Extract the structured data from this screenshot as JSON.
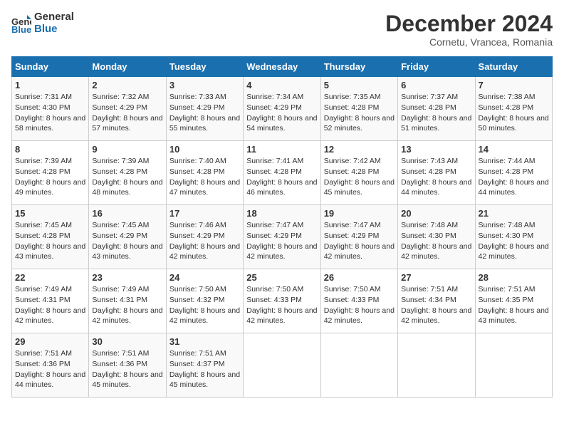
{
  "header": {
    "logo_line1": "General",
    "logo_line2": "Blue",
    "month": "December 2024",
    "location": "Cornetu, Vrancea, Romania"
  },
  "weekdays": [
    "Sunday",
    "Monday",
    "Tuesday",
    "Wednesday",
    "Thursday",
    "Friday",
    "Saturday"
  ],
  "weeks": [
    [
      {
        "day": "1",
        "sunrise": "Sunrise: 7:31 AM",
        "sunset": "Sunset: 4:30 PM",
        "daylight": "Daylight: 8 hours and 58 minutes."
      },
      {
        "day": "2",
        "sunrise": "Sunrise: 7:32 AM",
        "sunset": "Sunset: 4:29 PM",
        "daylight": "Daylight: 8 hours and 57 minutes."
      },
      {
        "day": "3",
        "sunrise": "Sunrise: 7:33 AM",
        "sunset": "Sunset: 4:29 PM",
        "daylight": "Daylight: 8 hours and 55 minutes."
      },
      {
        "day": "4",
        "sunrise": "Sunrise: 7:34 AM",
        "sunset": "Sunset: 4:29 PM",
        "daylight": "Daylight: 8 hours and 54 minutes."
      },
      {
        "day": "5",
        "sunrise": "Sunrise: 7:35 AM",
        "sunset": "Sunset: 4:28 PM",
        "daylight": "Daylight: 8 hours and 52 minutes."
      },
      {
        "day": "6",
        "sunrise": "Sunrise: 7:37 AM",
        "sunset": "Sunset: 4:28 PM",
        "daylight": "Daylight: 8 hours and 51 minutes."
      },
      {
        "day": "7",
        "sunrise": "Sunrise: 7:38 AM",
        "sunset": "Sunset: 4:28 PM",
        "daylight": "Daylight: 8 hours and 50 minutes."
      }
    ],
    [
      {
        "day": "8",
        "sunrise": "Sunrise: 7:39 AM",
        "sunset": "Sunset: 4:28 PM",
        "daylight": "Daylight: 8 hours and 49 minutes."
      },
      {
        "day": "9",
        "sunrise": "Sunrise: 7:39 AM",
        "sunset": "Sunset: 4:28 PM",
        "daylight": "Daylight: 8 hours and 48 minutes."
      },
      {
        "day": "10",
        "sunrise": "Sunrise: 7:40 AM",
        "sunset": "Sunset: 4:28 PM",
        "daylight": "Daylight: 8 hours and 47 minutes."
      },
      {
        "day": "11",
        "sunrise": "Sunrise: 7:41 AM",
        "sunset": "Sunset: 4:28 PM",
        "daylight": "Daylight: 8 hours and 46 minutes."
      },
      {
        "day": "12",
        "sunrise": "Sunrise: 7:42 AM",
        "sunset": "Sunset: 4:28 PM",
        "daylight": "Daylight: 8 hours and 45 minutes."
      },
      {
        "day": "13",
        "sunrise": "Sunrise: 7:43 AM",
        "sunset": "Sunset: 4:28 PM",
        "daylight": "Daylight: 8 hours and 44 minutes."
      },
      {
        "day": "14",
        "sunrise": "Sunrise: 7:44 AM",
        "sunset": "Sunset: 4:28 PM",
        "daylight": "Daylight: 8 hours and 44 minutes."
      }
    ],
    [
      {
        "day": "15",
        "sunrise": "Sunrise: 7:45 AM",
        "sunset": "Sunset: 4:28 PM",
        "daylight": "Daylight: 8 hours and 43 minutes."
      },
      {
        "day": "16",
        "sunrise": "Sunrise: 7:45 AM",
        "sunset": "Sunset: 4:29 PM",
        "daylight": "Daylight: 8 hours and 43 minutes."
      },
      {
        "day": "17",
        "sunrise": "Sunrise: 7:46 AM",
        "sunset": "Sunset: 4:29 PM",
        "daylight": "Daylight: 8 hours and 42 minutes."
      },
      {
        "day": "18",
        "sunrise": "Sunrise: 7:47 AM",
        "sunset": "Sunset: 4:29 PM",
        "daylight": "Daylight: 8 hours and 42 minutes."
      },
      {
        "day": "19",
        "sunrise": "Sunrise: 7:47 AM",
        "sunset": "Sunset: 4:29 PM",
        "daylight": "Daylight: 8 hours and 42 minutes."
      },
      {
        "day": "20",
        "sunrise": "Sunrise: 7:48 AM",
        "sunset": "Sunset: 4:30 PM",
        "daylight": "Daylight: 8 hours and 42 minutes."
      },
      {
        "day": "21",
        "sunrise": "Sunrise: 7:48 AM",
        "sunset": "Sunset: 4:30 PM",
        "daylight": "Daylight: 8 hours and 42 minutes."
      }
    ],
    [
      {
        "day": "22",
        "sunrise": "Sunrise: 7:49 AM",
        "sunset": "Sunset: 4:31 PM",
        "daylight": "Daylight: 8 hours and 42 minutes."
      },
      {
        "day": "23",
        "sunrise": "Sunrise: 7:49 AM",
        "sunset": "Sunset: 4:31 PM",
        "daylight": "Daylight: 8 hours and 42 minutes."
      },
      {
        "day": "24",
        "sunrise": "Sunrise: 7:50 AM",
        "sunset": "Sunset: 4:32 PM",
        "daylight": "Daylight: 8 hours and 42 minutes."
      },
      {
        "day": "25",
        "sunrise": "Sunrise: 7:50 AM",
        "sunset": "Sunset: 4:33 PM",
        "daylight": "Daylight: 8 hours and 42 minutes."
      },
      {
        "day": "26",
        "sunrise": "Sunrise: 7:50 AM",
        "sunset": "Sunset: 4:33 PM",
        "daylight": "Daylight: 8 hours and 42 minutes."
      },
      {
        "day": "27",
        "sunrise": "Sunrise: 7:51 AM",
        "sunset": "Sunset: 4:34 PM",
        "daylight": "Daylight: 8 hours and 42 minutes."
      },
      {
        "day": "28",
        "sunrise": "Sunrise: 7:51 AM",
        "sunset": "Sunset: 4:35 PM",
        "daylight": "Daylight: 8 hours and 43 minutes."
      }
    ],
    [
      {
        "day": "29",
        "sunrise": "Sunrise: 7:51 AM",
        "sunset": "Sunset: 4:36 PM",
        "daylight": "Daylight: 8 hours and 44 minutes."
      },
      {
        "day": "30",
        "sunrise": "Sunrise: 7:51 AM",
        "sunset": "Sunset: 4:36 PM",
        "daylight": "Daylight: 8 hours and 45 minutes."
      },
      {
        "day": "31",
        "sunrise": "Sunrise: 7:51 AM",
        "sunset": "Sunset: 4:37 PM",
        "daylight": "Daylight: 8 hours and 45 minutes."
      },
      null,
      null,
      null,
      null
    ]
  ]
}
